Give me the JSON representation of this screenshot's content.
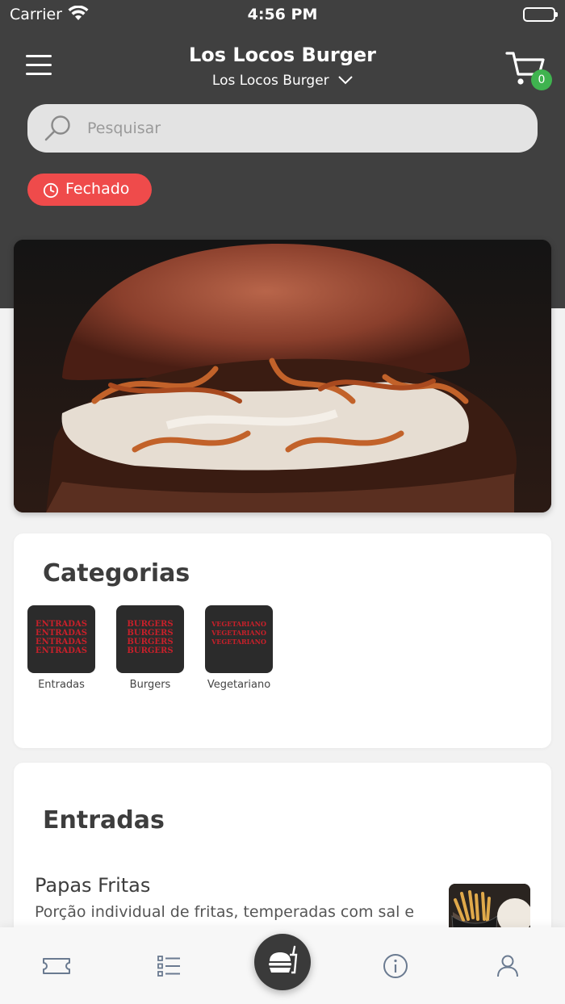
{
  "status_bar": {
    "carrier": "Carrier",
    "time": "4:56 PM"
  },
  "header": {
    "title": "Los Locos Burger",
    "store_selector": "Los Locos Burger",
    "cart_count": "0"
  },
  "search": {
    "placeholder": "Pesquisar"
  },
  "store_status": {
    "label": "Fechado",
    "color": "#ef4b4b"
  },
  "categories": {
    "title": "Categorias",
    "items": [
      {
        "label": "Entradas",
        "thumb_text": "ENTRADAS"
      },
      {
        "label": "Burgers",
        "thumb_text": "BURGERS"
      },
      {
        "label": "Vegetariano",
        "thumb_text": "VEGETARIANO"
      }
    ]
  },
  "section": {
    "title": "Entradas",
    "products": [
      {
        "name": "Papas Fritas",
        "description": "Porção individual de fritas, temperadas com sal e"
      }
    ]
  },
  "tab_bar": {
    "items": [
      {
        "icon": "ticket-icon"
      },
      {
        "icon": "list-icon"
      },
      {
        "icon": "burger-drink-icon"
      },
      {
        "icon": "info-icon"
      },
      {
        "icon": "user-icon"
      }
    ]
  },
  "colors": {
    "header_bg": "#404040",
    "accent_green": "#3fb34f",
    "closed_red": "#ef4b4b"
  }
}
